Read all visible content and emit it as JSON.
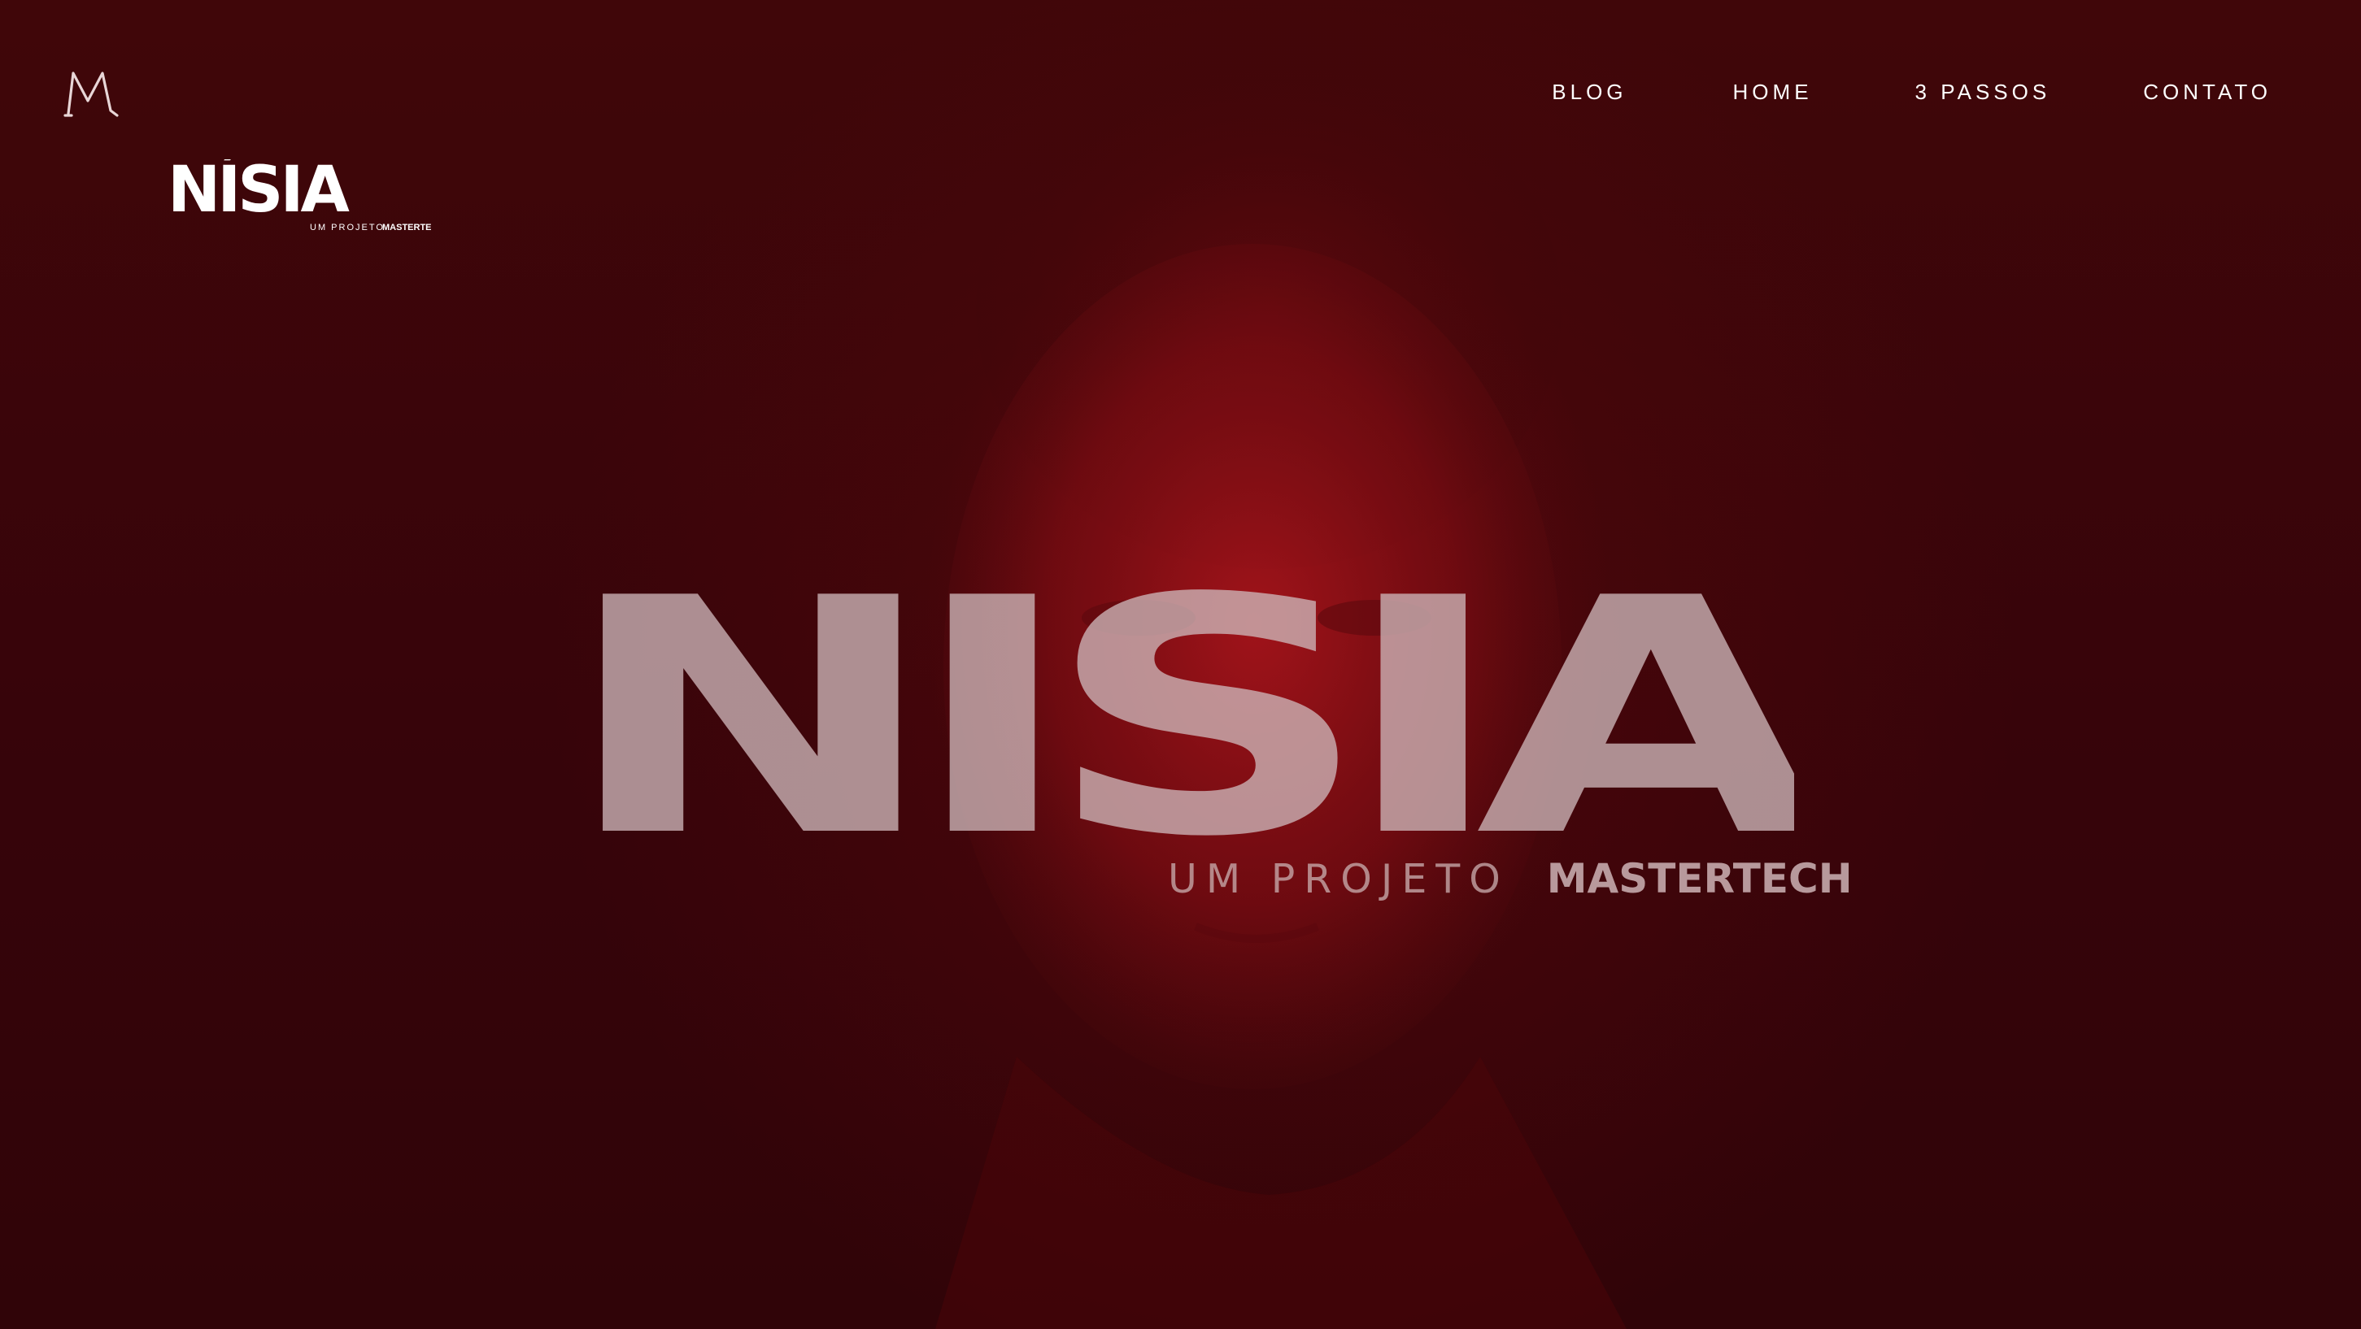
{
  "page": {
    "accent_color": "#3a0508",
    "highlight_color": "#8f1117",
    "wordmark_color": "#c8b0b2"
  },
  "header": {
    "m_logo_icon": "m-monogram-icon",
    "brand_logo": {
      "wordmark": "NÍSIA",
      "tagline_lead": "UM PROJETO",
      "tagline_brand": "MASTERTECH"
    },
    "nav": [
      {
        "label": "BLOG"
      },
      {
        "label": "HOME"
      },
      {
        "label": "3 PASSOS"
      },
      {
        "label": "CONTATO"
      }
    ]
  },
  "hero": {
    "wordmark": "NÍSIA",
    "subtitle_lead": "UM PROJETO",
    "subtitle_brand": "MASTERTECH",
    "background_image": "portrait-photo"
  }
}
